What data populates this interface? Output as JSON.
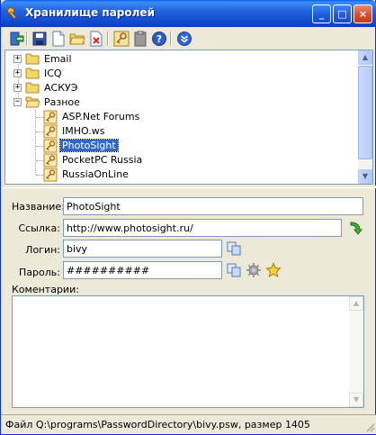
{
  "window": {
    "title": "Хранилище паролей",
    "controls": {
      "minimize": "_",
      "maximize": "□",
      "close": "×"
    }
  },
  "toolbar": {
    "buttons": [
      {
        "icon": "exit-icon"
      },
      {
        "icon": "save-icon"
      },
      {
        "icon": "new-file-icon"
      },
      {
        "icon": "open-folder-icon"
      },
      {
        "icon": "delete-icon"
      },
      {
        "icon": "key-icon"
      },
      {
        "icon": "clipboard-icon"
      },
      {
        "icon": "help-icon"
      },
      {
        "icon": "expand-down-icon"
      }
    ]
  },
  "tree": {
    "groups": [
      {
        "label": "Email",
        "expanded": false
      },
      {
        "label": "ICQ",
        "expanded": false
      },
      {
        "label": "АСКУЭ",
        "expanded": false
      },
      {
        "label": "Разное",
        "expanded": true
      }
    ],
    "items": [
      {
        "label": "ASP.Net Forums"
      },
      {
        "label": "IMHO.ws"
      },
      {
        "label": "PhotoSight",
        "selected": true
      },
      {
        "label": "PocketPC Russia"
      },
      {
        "label": "RussiaOnLine"
      }
    ]
  },
  "form": {
    "name_label": "Название:",
    "name_value": "PhotoSight",
    "url_label": "Ссылка:",
    "url_value": "http://www.photosight.ru/",
    "login_label": "Логин:",
    "login_value": "bivy",
    "password_label": "Пароль:",
    "password_value": "##########",
    "comments_label": "Коментарии:",
    "comments_value": ""
  },
  "status": {
    "text": "Файл Q:\\programs\\PasswordDirectory\\bivy.psw, размер 1405"
  },
  "colors": {
    "title_bar": "#0A5FE8",
    "selection": "#316AC5",
    "window_bg": "#ECE9D8"
  }
}
